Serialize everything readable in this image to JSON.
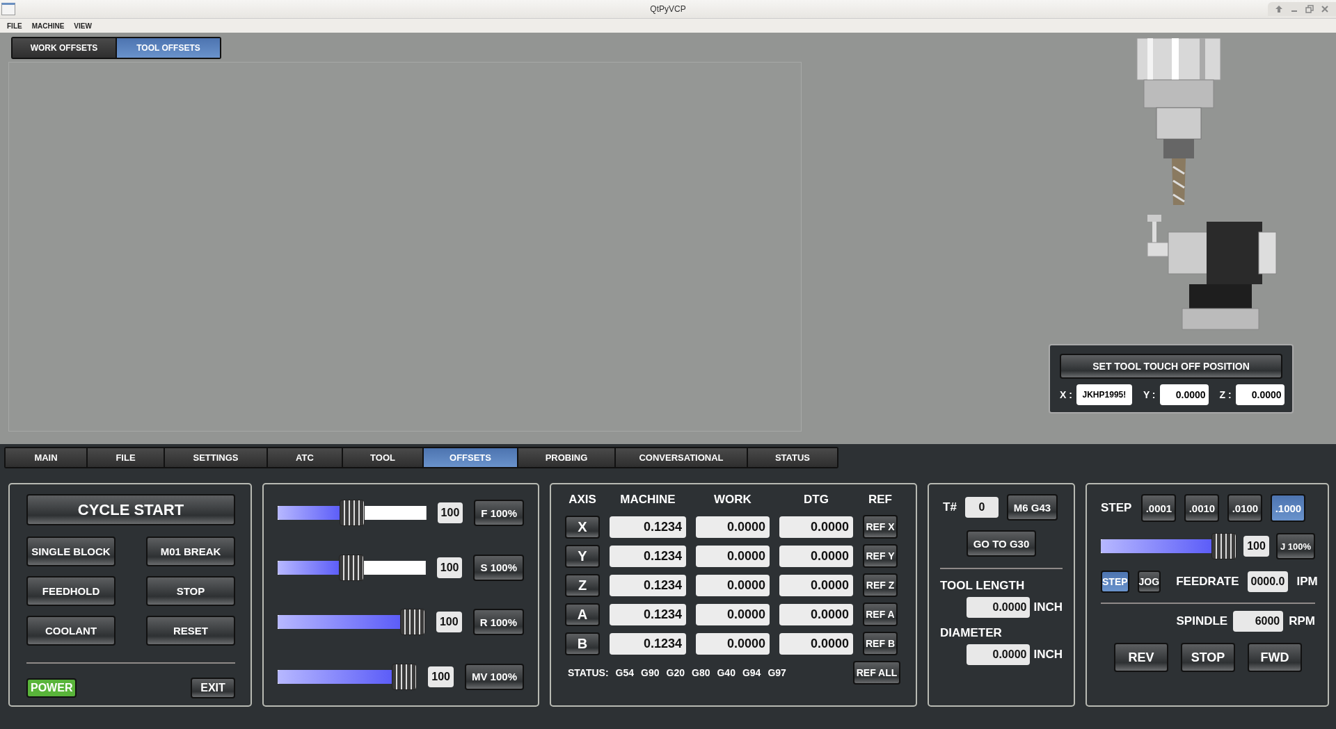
{
  "window": {
    "title": "QtPyVCP"
  },
  "menu": [
    "FILE",
    "MACHINE",
    "VIEW"
  ],
  "offset_tabs": [
    {
      "label": "WORK OFFSETS",
      "selected": false
    },
    {
      "label": "TOOL OFFSETS",
      "selected": true
    }
  ],
  "touch_off": {
    "button": "SET TOOL TOUCH OFF POSITION",
    "fields": [
      {
        "label": "X :",
        "value": "JKHP1995!"
      },
      {
        "label": "Y :",
        "value": "0.0000"
      },
      {
        "label": "Z :",
        "value": "0.0000"
      }
    ]
  },
  "main_tabs": [
    {
      "label": "MAIN",
      "selected": false
    },
    {
      "label": "FILE",
      "selected": false
    },
    {
      "label": "SETTINGS",
      "selected": false
    },
    {
      "label": "ATC",
      "selected": false
    },
    {
      "label": "TOOL",
      "selected": false
    },
    {
      "label": "OFFSETS",
      "selected": true
    },
    {
      "label": "PROBING",
      "selected": false
    },
    {
      "label": "CONVERSATIONAL",
      "selected": false
    },
    {
      "label": "STATUS",
      "selected": false
    }
  ],
  "program": {
    "cycle_start": "CYCLE START",
    "buttons": [
      "SINGLE BLOCK",
      "M01 BREAK",
      "FEEDHOLD",
      "STOP",
      "COOLANT",
      "RESET"
    ],
    "power": {
      "label": "POWER",
      "on": true
    },
    "exit": "EXIT"
  },
  "overrides": [
    {
      "level": 0.5,
      "value": "100",
      "button": "F 100%"
    },
    {
      "level": 0.5,
      "value": "100",
      "button": "S 100%"
    },
    {
      "level": 1,
      "value": "100",
      "button": "R 100%"
    },
    {
      "level": 1,
      "value": "100",
      "button": "MV 100%"
    }
  ],
  "dro": {
    "columns": [
      "AXIS",
      "MACHINE",
      "WORK",
      "DTG",
      "REF"
    ],
    "rows": [
      {
        "axis": "X",
        "machine": "0.1234",
        "work": "0.0000",
        "dtg": "0.0000",
        "ref": "REF X"
      },
      {
        "axis": "Y",
        "machine": "0.1234",
        "work": "0.0000",
        "dtg": "0.0000",
        "ref": "REF Y"
      },
      {
        "axis": "Z",
        "machine": "0.1234",
        "work": "0.0000",
        "dtg": "0.0000",
        "ref": "REF Z"
      },
      {
        "axis": "A",
        "machine": "0.1234",
        "work": "0.0000",
        "dtg": "0.0000",
        "ref": "REF A"
      },
      {
        "axis": "B",
        "machine": "0.1234",
        "work": "0.0000",
        "dtg": "0.0000",
        "ref": "REF B"
      }
    ],
    "status_label": "STATUS:",
    "status_codes": [
      "G54",
      "G90",
      "G20",
      "G80",
      "G40",
      "G94",
      "G97"
    ],
    "ref_all": "REF ALL"
  },
  "tool": {
    "label": "T#",
    "value": "0",
    "change_button": "M6 G43",
    "g30_button": "GO TO G30",
    "length_label": "TOOL LENGTH",
    "length_value": "0.0000",
    "length_unit": "INCH",
    "diameter_label": "DIAMETER",
    "diameter_value": "0.0000",
    "diameter_unit": "INCH"
  },
  "jog": {
    "step_label": "STEP",
    "steps": [
      {
        "label": ".0001",
        "selected": false
      },
      {
        "label": ".0010",
        "selected": false
      },
      {
        "label": ".0100",
        "selected": false
      },
      {
        "label": ".1000",
        "selected": true
      }
    ],
    "slider": {
      "level": 1,
      "value": "100",
      "button": "J 100%"
    },
    "modes": [
      {
        "label": "STEP",
        "selected": true
      },
      {
        "label": "JOG",
        "selected": false
      }
    ],
    "feedrate_label": "FEEDRATE",
    "feedrate_value": "0000.0",
    "feedrate_unit": "IPM",
    "spindle_label": "SPINDLE",
    "spindle_value": "6000",
    "spindle_unit": "RPM",
    "spindle_buttons": [
      "REV",
      "STOP",
      "FWD"
    ]
  }
}
